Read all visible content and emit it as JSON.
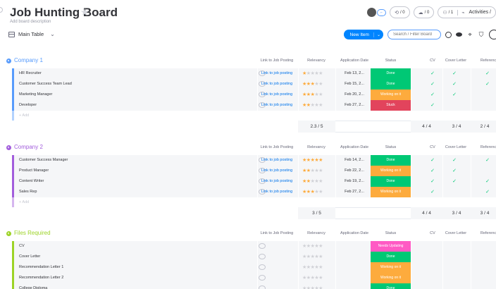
{
  "board": {
    "title": "Job Hunting Board",
    "description": "Add board description",
    "view": "Main Table"
  },
  "top_bar": {
    "invite_count": "/ 0",
    "automations_count": "/ 0",
    "members_count": "/ 1",
    "activities_label": "Activities /"
  },
  "toolbar": {
    "new_item": "New Item",
    "search_placeholder": "Search / Filter Board"
  },
  "columns": {
    "link": "Link to Job Posting",
    "relevancy": "Relevancy",
    "app_date": "Application Date",
    "status": "Status",
    "cv": "CV",
    "cover": "Cover Letter",
    "reference": "Referenc"
  },
  "colors": {
    "done": "#00c875",
    "working": "#fdab3d",
    "stuck": "#e2445c",
    "needs_updating": "#ff5ac4",
    "group1": "#579bfc",
    "group2": "#a25ddc",
    "group3": "#9cd326"
  },
  "groups": [
    {
      "name": "Company 1",
      "color": "#579bfc",
      "add_label": "+ Add",
      "rows": [
        {
          "name": "HR Recruiter",
          "link": "Link to job posting",
          "stars": 1,
          "date": "Feb 13, 2...",
          "status": "Done",
          "status_color": "#00c875",
          "cv": "✓",
          "cover": "✓",
          "ref": "✓"
        },
        {
          "name": "Customer Success Team Lead",
          "link": "Link to job posting",
          "stars": 3,
          "date": "Feb 15, 2...",
          "status": "Done",
          "status_color": "#00c875",
          "cv": "✓",
          "cover": "✓",
          "ref": "✓"
        },
        {
          "name": "Marketing Manager",
          "link": "Link to job posting",
          "stars": 3,
          "date": "Feb 20, 2...",
          "status": "Working on it",
          "status_color": "#fdab3d",
          "cv": "✓",
          "cover": "✓",
          "ref": ""
        },
        {
          "name": "Developer",
          "link": "Link to job posting",
          "stars": 2,
          "date": "Feb 27, 2...",
          "status": "Stuck",
          "status_color": "#e2445c",
          "cv": "✓",
          "cover": "",
          "ref": ""
        }
      ],
      "summary": {
        "relevancy": "2.3 / 5",
        "cv": "4 / 4",
        "cover": "3 / 4",
        "ref": "2 / 4"
      }
    },
    {
      "name": "Company 2",
      "color": "#a25ddc",
      "add_label": "+ Add",
      "rows": [
        {
          "name": "Customer Success Manager",
          "link": "Link to job posting",
          "stars": 5,
          "date": "Feb 14, 2...",
          "status": "Done",
          "status_color": "#00c875",
          "cv": "✓",
          "cover": "✓",
          "ref": "✓"
        },
        {
          "name": "Product Manager",
          "link": "Link to job posting",
          "stars": 2,
          "date": "Feb 22, 2...",
          "status": "Working on it",
          "status_color": "#fdab3d",
          "cv": "✓",
          "cover": "✓",
          "ref": ""
        },
        {
          "name": "Content Writer",
          "link": "Link to job posting",
          "stars": 2,
          "date": "Feb 19, 2...",
          "status": "Done",
          "status_color": "#00c875",
          "cv": "✓",
          "cover": "✓",
          "ref": "✓"
        },
        {
          "name": "Sales Rep",
          "link": "Link to job posting",
          "stars": 3,
          "date": "Feb 27, 2...",
          "status": "Working on it",
          "status_color": "#fdab3d",
          "cv": "✓",
          "cover": "",
          "ref": "✓"
        }
      ],
      "summary": {
        "relevancy": "3 / 5",
        "cv": "4 / 4",
        "cover": "3 / 4",
        "ref": "3 / 4"
      }
    },
    {
      "name": "Files Required",
      "color": "#9cd326",
      "rows": [
        {
          "name": "CV",
          "link": "",
          "stars": 0,
          "date": "",
          "status": "Needs Updating",
          "status_color": "#ff5ac4",
          "cv": "",
          "cover": "",
          "ref": ""
        },
        {
          "name": "Cover Letter",
          "link": "",
          "stars": 0,
          "date": "",
          "status": "Done",
          "status_color": "#00c875",
          "cv": "",
          "cover": "",
          "ref": ""
        },
        {
          "name": "Recommendation Letter 1",
          "link": "",
          "stars": 0,
          "date": "",
          "status": "Working on it",
          "status_color": "#fdab3d",
          "cv": "",
          "cover": "",
          "ref": ""
        },
        {
          "name": "Recommendation Letter 2",
          "link": "",
          "stars": 0,
          "date": "",
          "status": "Working on it",
          "status_color": "#fdab3d",
          "cv": "",
          "cover": "",
          "ref": ""
        },
        {
          "name": "College Diploma",
          "link": "",
          "stars": 0,
          "date": "",
          "status": "Done",
          "status_color": "#00c875",
          "cv": "",
          "cover": "",
          "ref": ""
        }
      ]
    }
  ]
}
